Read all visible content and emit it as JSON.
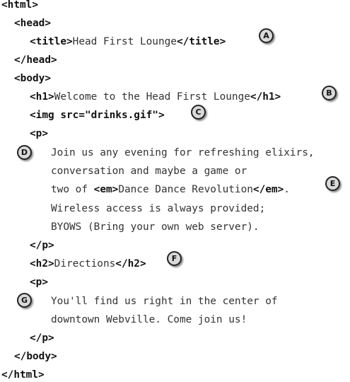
{
  "lines": {
    "html_open": "<html>",
    "head_open": "<head>",
    "title_open": "<title>",
    "title_text": "Head First Lounge",
    "title_close": "</title>",
    "head_close": "</head>",
    "body_open": "<body>",
    "h1_open": "<h1>",
    "h1_text": "Welcome to the Head First Lounge",
    "h1_close": "</h1>",
    "img_tag": "<img src=\"drinks.gif\">",
    "p1_open": "<p>",
    "p1_line1": "Join us any evening for refreshing elixirs,",
    "p1_line2": "conversation and maybe a game or",
    "p1_line3_pre": "two of ",
    "em_open": "<em>",
    "em_text": "Dance Dance Revolution",
    "em_close": "</em>",
    "p1_line3_post": ".",
    "p1_line4": "Wireless access is always provided;",
    "p1_line5": "BYOWS (Bring your own web server).",
    "p1_close": "</p>",
    "h2_open": "<h2>",
    "h2_text": "Directions",
    "h2_close": "</h2>",
    "p2_open": "<p>",
    "p2_line1": "You'll find us right in the center of",
    "p2_line2": "downtown Webville. Come join us!",
    "p2_close": "</p>",
    "body_close": "</body>",
    "html_close": "</html>"
  },
  "annotations": {
    "a": "A",
    "b": "B",
    "c": "C",
    "d": "D",
    "e": "E",
    "f": "F",
    "g": "G"
  }
}
